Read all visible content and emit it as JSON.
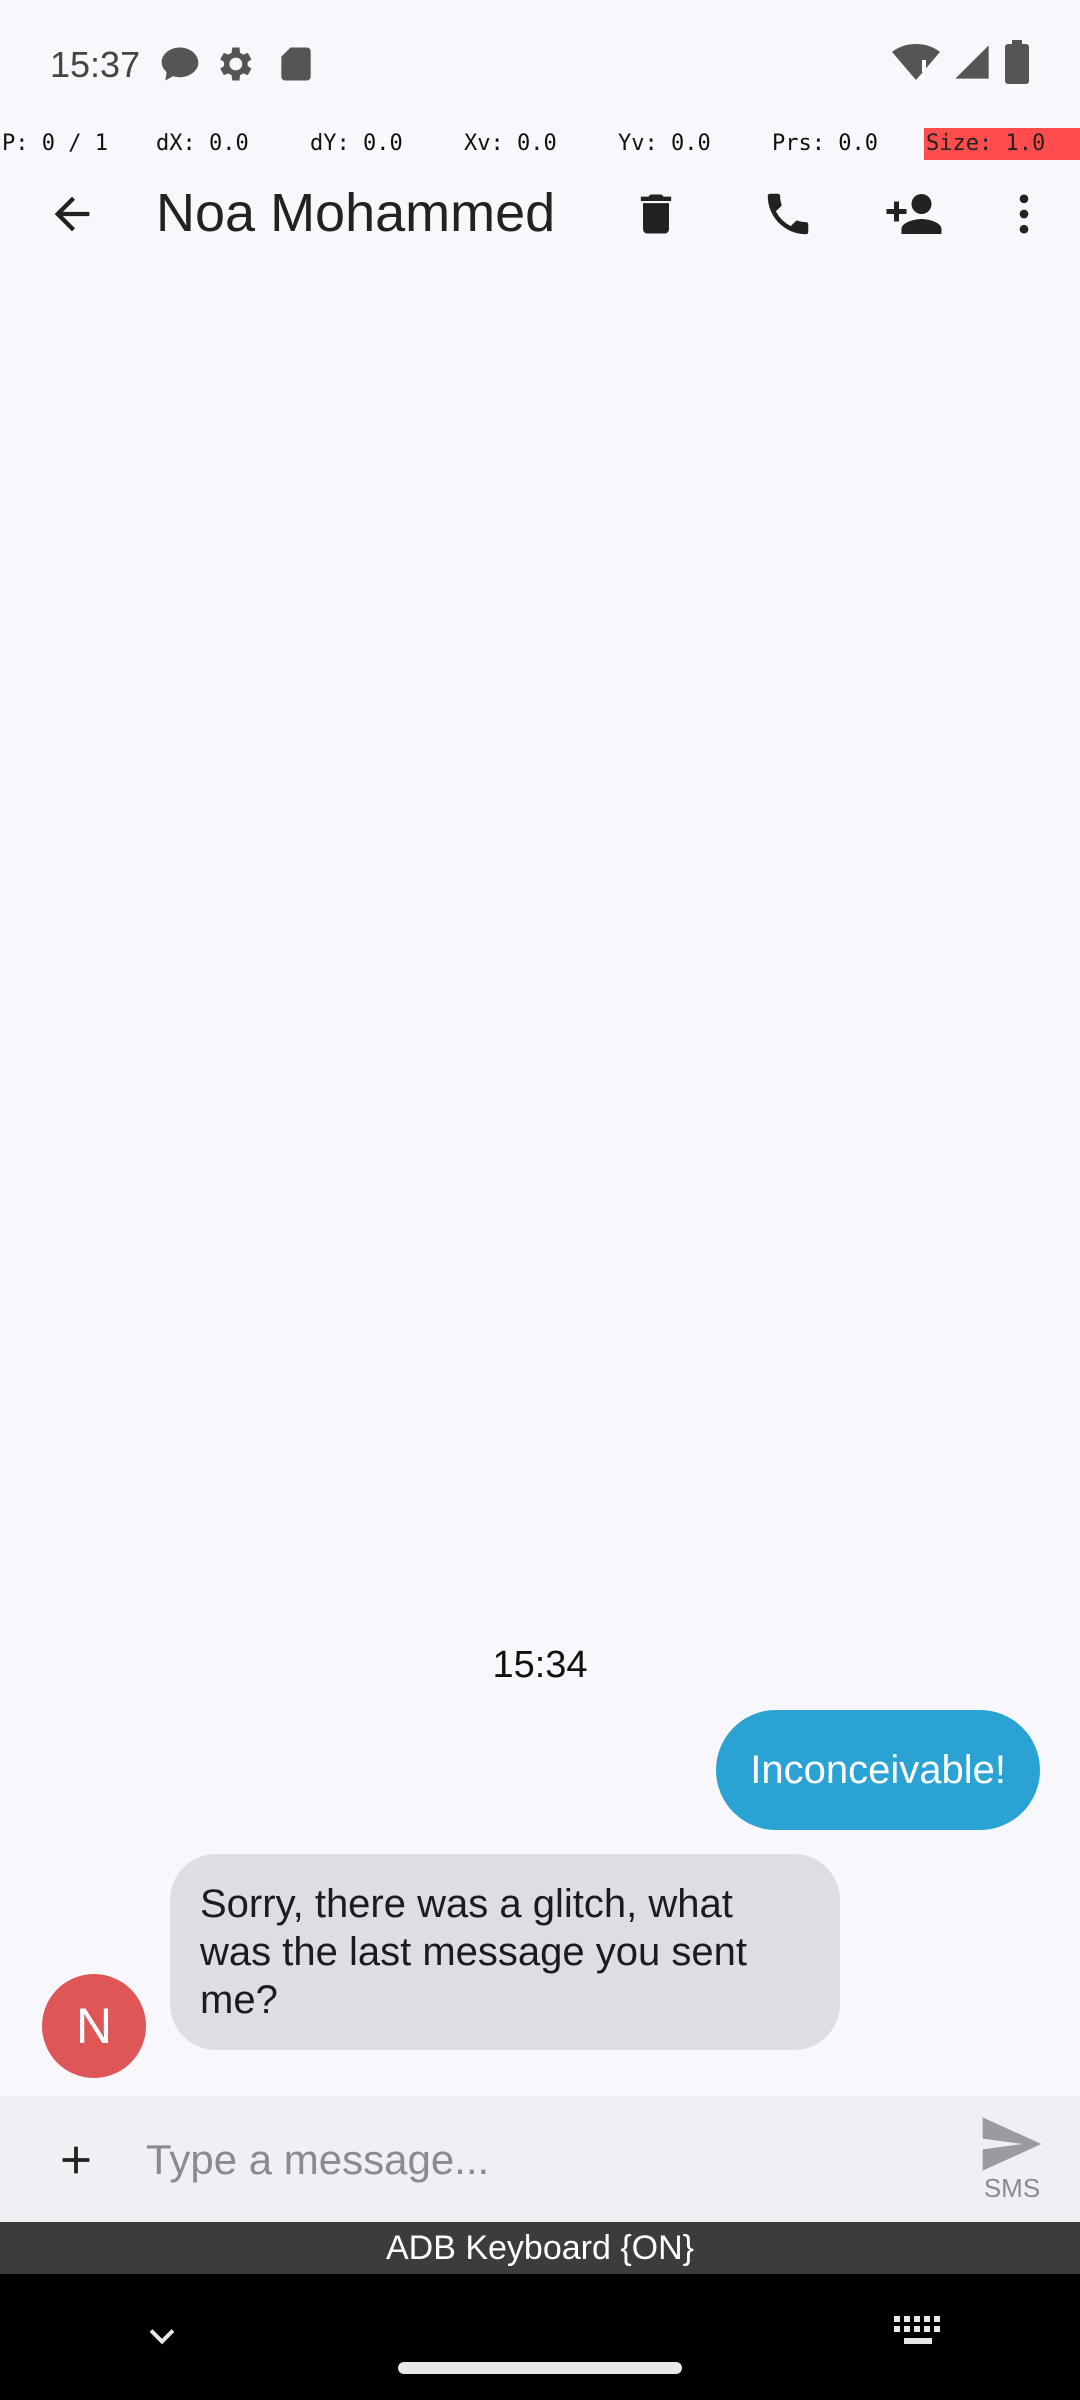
{
  "status_bar": {
    "time": "15:37",
    "icons": [
      "chat-bubble-icon",
      "settings-gear-icon",
      "sd-card-icon",
      "wifi-alert-icon",
      "cell-signal-icon",
      "battery-icon"
    ]
  },
  "debug": {
    "pointer": "P: 0 / 1",
    "dx": "dX: 0.0",
    "dy": "dY: 0.0",
    "xv": "Xv: 0.0",
    "yv": "Yv: 0.0",
    "prs": "Prs: 0.0",
    "size": "Size: 1.0"
  },
  "toolbar": {
    "contact_name": "Noa Mohammed",
    "icons": [
      "back-arrow-icon",
      "delete-icon",
      "phone-icon",
      "add-contact-icon",
      "more-vert-icon"
    ]
  },
  "conversation": {
    "timestamp": "15:34",
    "messages": [
      {
        "direction": "outgoing",
        "text": "Inconceivable!"
      },
      {
        "direction": "incoming",
        "text": "Sorry, there was a glitch, what was the last message you sent me?",
        "avatar_letter": "N"
      }
    ]
  },
  "compose": {
    "placeholder": "Type a message...",
    "value": "",
    "send_label": "SMS"
  },
  "keyboard": {
    "banner": "ADB Keyboard {ON}"
  },
  "colors": {
    "outgoing_bubble": "#2aa2d3",
    "incoming_bubble": "#dedde1",
    "avatar": "#de5656",
    "background": "#f8f7fb"
  }
}
